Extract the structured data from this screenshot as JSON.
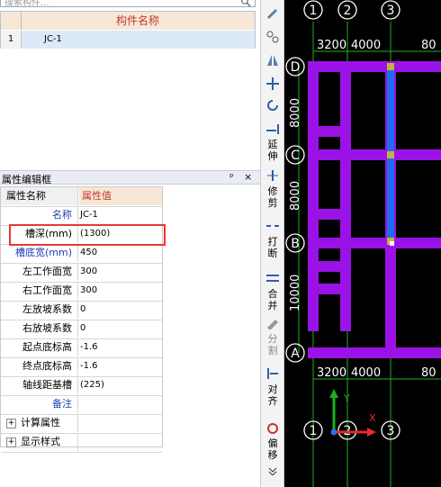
{
  "search": {
    "placeholder": "搜索构件..."
  },
  "component_table": {
    "header": "构件名称",
    "rows": [
      {
        "num": "1",
        "name": "JC-1"
      }
    ]
  },
  "prop_panel": {
    "title": "属性编辑框",
    "pin": "ᵖ",
    "close": "×"
  },
  "prop_table": {
    "col_name": "属性名称",
    "col_value": "属性值",
    "rows": [
      {
        "name": "名称",
        "value": "JC-1"
      },
      {
        "name": "槽深(mm)",
        "value": "(1300)"
      },
      {
        "name": "槽底宽(mm)",
        "value": "450"
      },
      {
        "name": "左工作面宽",
        "value": "300"
      },
      {
        "name": "右工作面宽",
        "value": "300"
      },
      {
        "name": "左放坡系数",
        "value": "0"
      },
      {
        "name": "右放坡系数",
        "value": "0"
      },
      {
        "name": "起点底标高",
        "value": "-1.6"
      },
      {
        "name": "终点底标高",
        "value": "-1.6"
      },
      {
        "name": "轴线距基槽",
        "value": "(225)"
      },
      {
        "name": "备注",
        "value": ""
      }
    ],
    "sections": [
      {
        "name": "计算属性"
      },
      {
        "name": "显示样式"
      }
    ]
  },
  "toolbar": {
    "items": [
      {
        "icon": "extend-icon",
        "label": "延伸"
      },
      {
        "icon": "trim-icon",
        "label": "修剪"
      },
      {
        "icon": "break-icon",
        "label": "打断"
      },
      {
        "icon": "merge-icon",
        "label": "合并"
      },
      {
        "icon": "split-icon",
        "label": "分割"
      },
      {
        "icon": "align-icon",
        "label": "对齐"
      },
      {
        "icon": "offset-icon",
        "label": "偏移"
      }
    ]
  },
  "cad": {
    "top_axes": [
      "1",
      "2",
      "3"
    ],
    "top_dims": [
      "3200",
      "4000",
      "80"
    ],
    "bottom_dims": [
      "3200",
      "4000",
      "80"
    ],
    "bottom_axes": [
      "1",
      "2",
      "3"
    ],
    "row_axes": [
      "D",
      "C",
      "B",
      "A"
    ],
    "row_dims": [
      "8000",
      "8000",
      "10000"
    ],
    "ucs": {
      "y": "Y",
      "x": "X"
    },
    "colors": {
      "beam": "#9b12e6",
      "selected": "#1e6cf0",
      "grid": "#1fae1f",
      "axis_label": "#ffffff"
    }
  }
}
